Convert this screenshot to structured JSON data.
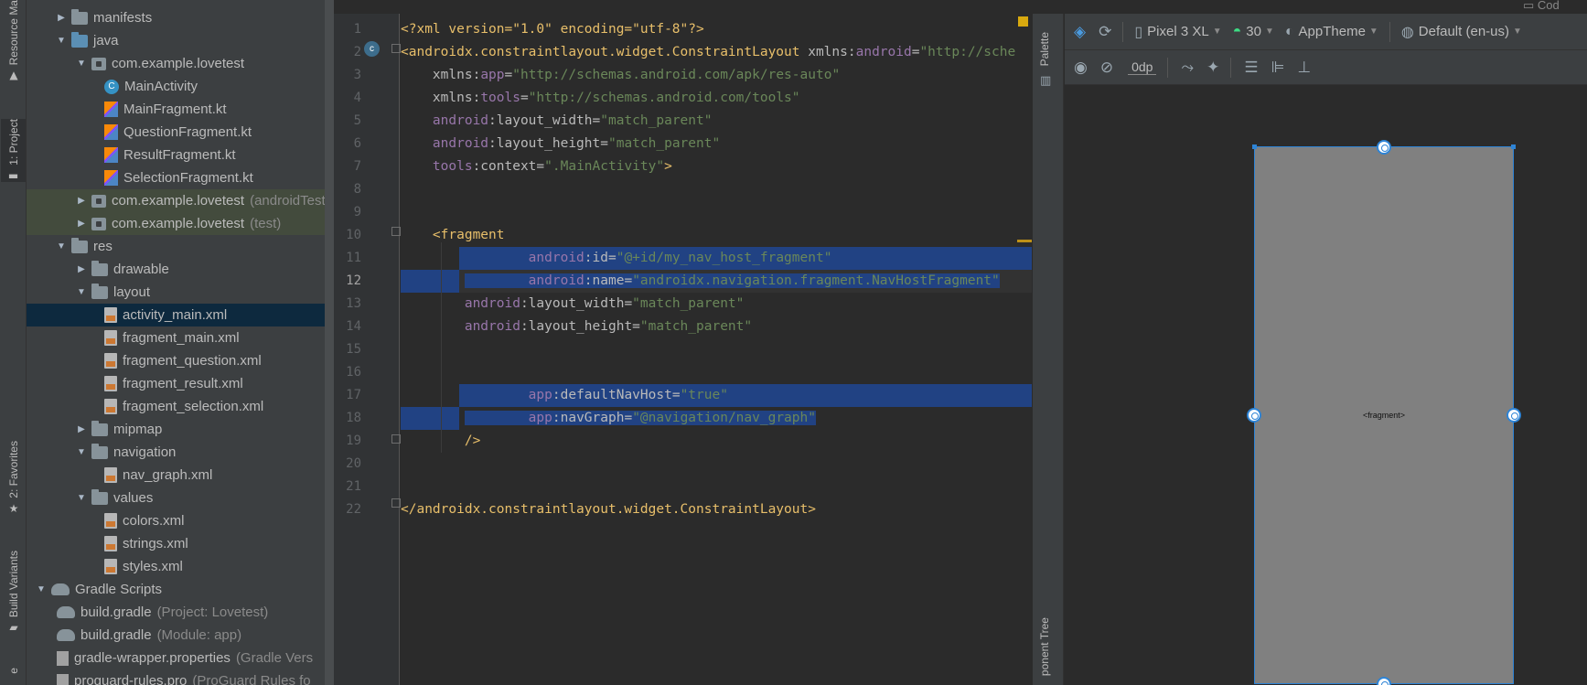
{
  "left_tool_strip": {
    "tabs": [
      {
        "label": "Resource Ma",
        "icon": "resource-icon"
      },
      {
        "label": "1: Project",
        "icon": "folder-icon"
      },
      {
        "label": "2: Favorites",
        "icon": "star-icon"
      },
      {
        "label": "Build Variants",
        "icon": "build-variants-icon"
      }
    ]
  },
  "project_tree": {
    "items": [
      {
        "label": "manifests",
        "depth": 1,
        "expanded": false,
        "icon": "folder-icon"
      },
      {
        "label": "java",
        "depth": 1,
        "expanded": true,
        "icon": "folder-blue-icon"
      },
      {
        "label": "com.example.lovetest",
        "depth": 2,
        "expanded": true,
        "icon": "package-icon"
      },
      {
        "label": "MainActivity",
        "depth": 3,
        "icon": "kotlin-class-icon"
      },
      {
        "label": "MainFragment.kt",
        "depth": 3,
        "icon": "kotlin-file-icon"
      },
      {
        "label": "QuestionFragment.kt",
        "depth": 3,
        "icon": "kotlin-file-icon"
      },
      {
        "label": "ResultFragment.kt",
        "depth": 3,
        "icon": "kotlin-file-icon"
      },
      {
        "label": "SelectionFragment.kt",
        "depth": 3,
        "icon": "kotlin-file-icon"
      },
      {
        "label": "com.example.lovetest",
        "suffix": "(androidTest)",
        "depth": 2,
        "expanded": false,
        "icon": "package-icon"
      },
      {
        "label": "com.example.lovetest",
        "suffix": "(test)",
        "depth": 2,
        "expanded": false,
        "icon": "package-icon"
      },
      {
        "label": "res",
        "depth": 1,
        "expanded": true,
        "icon": "res-folder-icon"
      },
      {
        "label": "drawable",
        "depth": 2,
        "expanded": false,
        "icon": "folder-icon"
      },
      {
        "label": "layout",
        "depth": 2,
        "expanded": true,
        "icon": "folder-icon"
      },
      {
        "label": "activity_main.xml",
        "depth": 3,
        "icon": "xml-layout-icon",
        "selected": true
      },
      {
        "label": "fragment_main.xml",
        "depth": 3,
        "icon": "xml-layout-icon"
      },
      {
        "label": "fragment_question.xml",
        "depth": 3,
        "icon": "xml-layout-icon"
      },
      {
        "label": "fragment_result.xml",
        "depth": 3,
        "icon": "xml-layout-icon"
      },
      {
        "label": "fragment_selection.xml",
        "depth": 3,
        "icon": "xml-layout-icon"
      },
      {
        "label": "mipmap",
        "depth": 2,
        "expanded": false,
        "icon": "folder-icon"
      },
      {
        "label": "navigation",
        "depth": 2,
        "expanded": true,
        "icon": "folder-icon"
      },
      {
        "label": "nav_graph.xml",
        "depth": 3,
        "icon": "xml-layout-icon"
      },
      {
        "label": "values",
        "depth": 2,
        "expanded": true,
        "icon": "folder-icon"
      },
      {
        "label": "colors.xml",
        "depth": 3,
        "icon": "xml-layout-icon"
      },
      {
        "label": "strings.xml",
        "depth": 3,
        "icon": "xml-layout-icon"
      },
      {
        "label": "styles.xml",
        "depth": 3,
        "icon": "xml-layout-icon"
      },
      {
        "label": "Gradle Scripts",
        "depth": 0,
        "expanded": true,
        "icon": "gradle-icon"
      },
      {
        "label": "build.gradle",
        "suffix": "(Project: Lovetest)",
        "depth": 1,
        "icon": "gradle-icon"
      },
      {
        "label": "build.gradle",
        "suffix": "(Module: app)",
        "depth": 1,
        "icon": "gradle-icon"
      },
      {
        "label": "gradle-wrapper.properties",
        "suffix": "(Gradle Vers",
        "depth": 1,
        "icon": "properties-icon"
      },
      {
        "label": "proguard-rules.pro",
        "suffix": "(ProGuard Rules fo",
        "depth": 1,
        "icon": "properties-icon"
      }
    ]
  },
  "editor": {
    "current_line": 12,
    "lines": [
      {
        "n": "1",
        "tokens": [
          [
            "pi",
            "<?xml version=\"1.0\" encoding=\"utf-8\"?>"
          ]
        ]
      },
      {
        "n": "2",
        "tokens": [
          [
            "tag",
            "<androidx.constraintlayout.widget.ConstraintLayout "
          ],
          [
            "attr",
            "xmlns:"
          ],
          [
            "ns",
            "android"
          ],
          [
            "attr",
            "="
          ],
          [
            "str",
            "\"http://sche"
          ]
        ]
      },
      {
        "n": "3",
        "tokens": [
          [
            "attr",
            "    xmlns:"
          ],
          [
            "ns",
            "app"
          ],
          [
            "attr",
            "="
          ],
          [
            "str",
            "\"http://schemas.android.com/apk/res-auto\""
          ]
        ]
      },
      {
        "n": "4",
        "tokens": [
          [
            "attr",
            "    xmlns:"
          ],
          [
            "ns",
            "tools"
          ],
          [
            "attr",
            "="
          ],
          [
            "str",
            "\"http://schemas.android.com/tools\""
          ]
        ]
      },
      {
        "n": "5",
        "tokens": [
          [
            "ns",
            "    android"
          ],
          [
            "attr",
            ":layout_width="
          ],
          [
            "str",
            "\"match_parent\""
          ]
        ]
      },
      {
        "n": "6",
        "tokens": [
          [
            "ns",
            "    android"
          ],
          [
            "attr",
            ":layout_height="
          ],
          [
            "str",
            "\"match_parent\""
          ]
        ]
      },
      {
        "n": "7",
        "tokens": [
          [
            "ns",
            "    tools"
          ],
          [
            "attr",
            ":context="
          ],
          [
            "str",
            "\".MainActivity\""
          ],
          [
            "tag",
            ">"
          ]
        ]
      },
      {
        "n": "8",
        "tokens": []
      },
      {
        "n": "9",
        "tokens": []
      },
      {
        "n": "10",
        "tokens": [
          [
            "tag",
            "    <fragment"
          ]
        ]
      },
      {
        "n": "11",
        "tokens": [
          [
            "ns",
            "        android"
          ],
          [
            "attr",
            ":id="
          ],
          [
            "str",
            "\"@+id/my_nav_host_fragment\""
          ]
        ],
        "highlight": true
      },
      {
        "n": "12",
        "tokens": [
          [
            "ns",
            "        android"
          ],
          [
            "attr",
            ":name="
          ],
          [
            "str",
            "\"androidx.navigation.fragment.NavHostFragment\""
          ]
        ],
        "highlight": true
      },
      {
        "n": "13",
        "tokens": [
          [
            "ns",
            "        android"
          ],
          [
            "attr",
            ":layout_width="
          ],
          [
            "str",
            "\"match_parent\""
          ]
        ]
      },
      {
        "n": "14",
        "tokens": [
          [
            "ns",
            "        android"
          ],
          [
            "attr",
            ":layout_height="
          ],
          [
            "str",
            "\"match_parent\""
          ]
        ]
      },
      {
        "n": "15",
        "tokens": []
      },
      {
        "n": "16",
        "tokens": []
      },
      {
        "n": "17",
        "tokens": [
          [
            "ns",
            "        app"
          ],
          [
            "attr",
            ":defaultNavHost="
          ],
          [
            "str",
            "\"true\""
          ]
        ],
        "highlight": true
      },
      {
        "n": "18",
        "tokens": [
          [
            "ns",
            "        app"
          ],
          [
            "attr",
            ":navGraph="
          ],
          [
            "str",
            "\"@navigation/nav_graph\""
          ]
        ],
        "highlight": true
      },
      {
        "n": "19",
        "tokens": [
          [
            "tag",
            "        />"
          ]
        ]
      },
      {
        "n": "20",
        "tokens": []
      },
      {
        "n": "21",
        "tokens": []
      },
      {
        "n": "22",
        "tokens": [
          [
            "tag",
            "</androidx.constraintlayout.widget.ConstraintLayout>"
          ]
        ]
      }
    ]
  },
  "palette_strip": {
    "palette_label": "Palette",
    "component_tree_label": "ponent Tree"
  },
  "design_toolbar": {
    "device": "Pixel 3 XL",
    "api": "30",
    "theme": "AppTheme",
    "locale": "Default (en-us)",
    "margin": "0dp",
    "top_right": "Cod"
  },
  "preview": {
    "label": "<fragment>"
  },
  "colors": {
    "selection": "#214283",
    "tree_selection": "#0d293e",
    "accent": "#2e84d6"
  }
}
